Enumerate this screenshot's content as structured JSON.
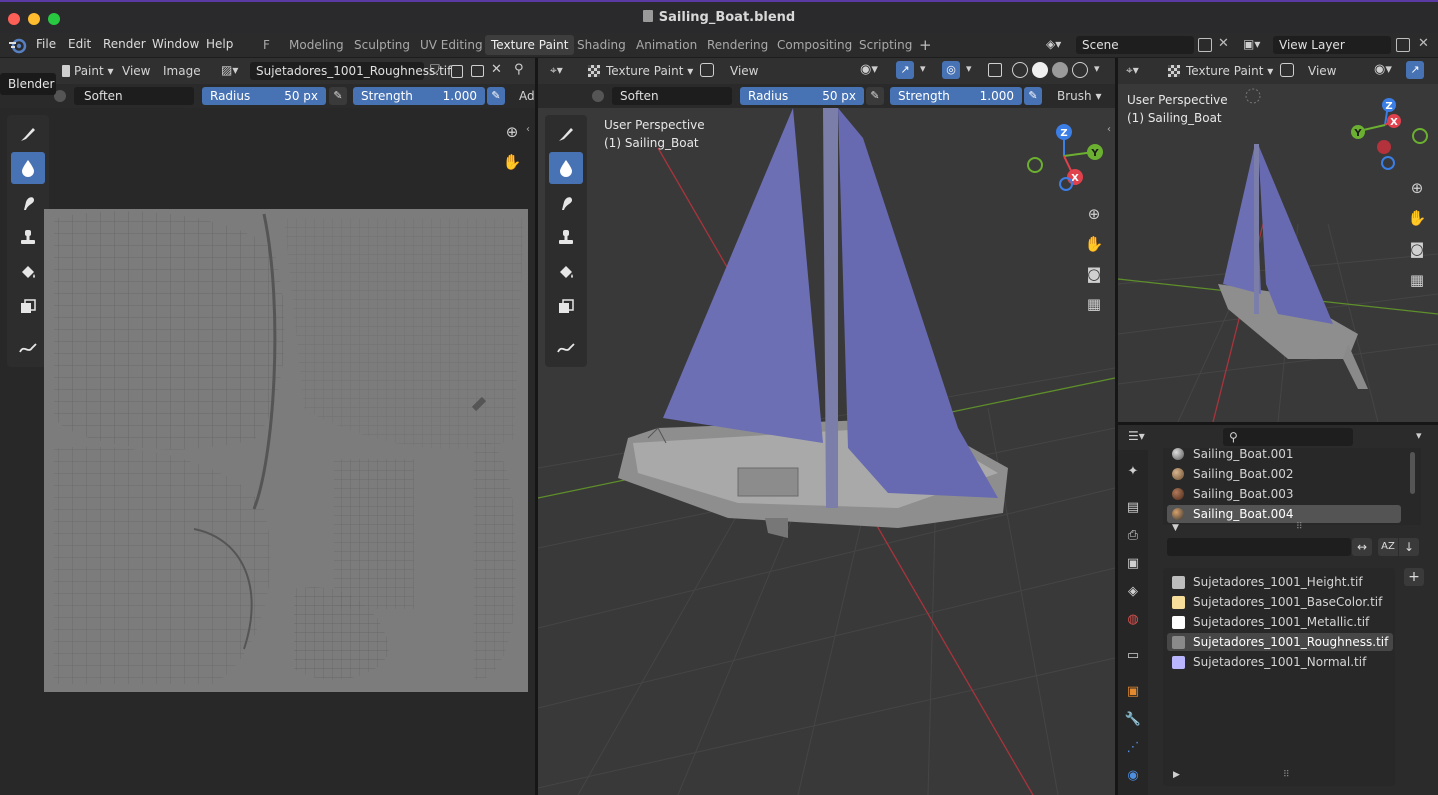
{
  "window": {
    "title": "Sailing_Boat.blend"
  },
  "menu": {
    "items": [
      "File",
      "Edit",
      "Render",
      "Window",
      "Help"
    ],
    "tooltip": "Blender"
  },
  "workspaces": {
    "tabs": [
      "F",
      "Modeling",
      "Sculpting",
      "UV Editing",
      "Texture Paint",
      "Shading",
      "Animation",
      "Rendering",
      "Compositing",
      "Scripting"
    ],
    "active": "Texture Paint",
    "add_symbol": "+"
  },
  "scene": {
    "label": "Scene",
    "view_layer": "View Layer"
  },
  "image_editor": {
    "mode": "Paint",
    "menus": [
      "View",
      "Image"
    ],
    "image_name": "Sujetadores_1001_Roughness.tif",
    "brush_name": "Soften",
    "radius_label": "Radius",
    "radius_value": "50 px",
    "strength_label": "Strength",
    "strength_value": "1.000",
    "adv_label": "Adv"
  },
  "viewport_main": {
    "mode": "Texture Paint",
    "menu_view": "View",
    "brush_name": "Soften",
    "radius_label": "Radius",
    "radius_value": "50 px",
    "strength_label": "Strength",
    "strength_value": "1.000",
    "brush_menu": "Brush",
    "perspective": "User Perspective",
    "object": "(1) Sailing_Boat",
    "axes": {
      "x": "X",
      "y": "Y",
      "z": "Z"
    }
  },
  "viewport_small": {
    "mode": "Texture Paint",
    "menu_view": "View",
    "perspective": "User Perspective",
    "object": "(1) Sailing_Boat"
  },
  "properties": {
    "materials": [
      {
        "name": "Sailing_Boat.001",
        "color": "#8a8a8a",
        "selected": false
      },
      {
        "name": "Sailing_Boat.002",
        "color": "#a07a55",
        "selected": false
      },
      {
        "name": "Sailing_Boat.003",
        "color": "#7a4a30",
        "selected": false
      },
      {
        "name": "Sailing_Boat.004",
        "color": "#6a6a6a",
        "selected": true
      }
    ],
    "sort_label": "AZ",
    "textures": [
      {
        "name": "Sujetadores_1001_Height.tif",
        "color": "#bdbdbd",
        "selected": false
      },
      {
        "name": "Sujetadores_1001_BaseColor.tif",
        "color": "#f6dd9a",
        "selected": false
      },
      {
        "name": "Sujetadores_1001_Metallic.tif",
        "color": "#ffffff",
        "selected": false
      },
      {
        "name": "Sujetadores_1001_Roughness.tif",
        "color": "#8a8a8a",
        "selected": true
      },
      {
        "name": "Sujetadores_1001_Normal.tif",
        "color": "#b9b6ff",
        "selected": false
      }
    ],
    "add_symbol": "+"
  },
  "colors": {
    "accent": "#4772b3",
    "axis_x": "#e0414d",
    "axis_y": "#6bb030",
    "axis_z": "#3a7ee6",
    "sail": "#6c6fb4",
    "titlebar_stripe": "#5b3aa6"
  }
}
